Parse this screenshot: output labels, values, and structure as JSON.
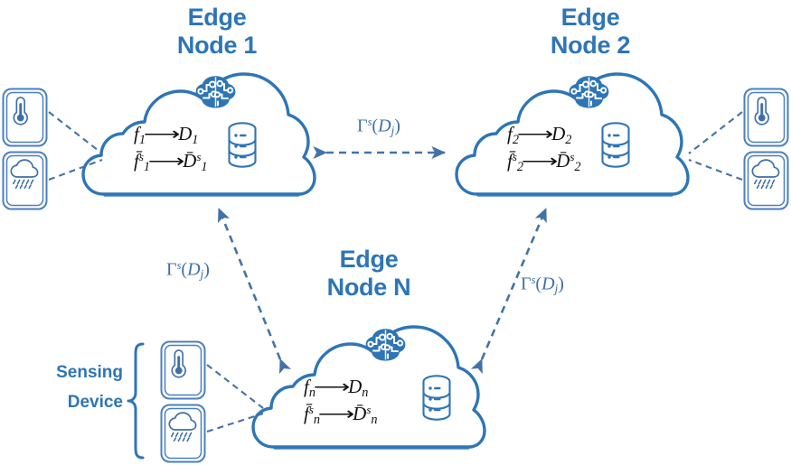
{
  "diagram": {
    "title": "Edge computing federated sensing network",
    "colors": {
      "node_blue": "#2E75B6",
      "arrow_blue": "#4472A8",
      "icon_blue": "#3E6FA8",
      "formula_black": "#111111",
      "background": "#FFFFFF"
    }
  },
  "nodes": [
    {
      "id": "edge-node-1",
      "title": "Edge\nNode 1",
      "formula_line1": {
        "fn": "f",
        "fn_sub": "1",
        "arrow": "⟶",
        "data": "D",
        "data_sub": "1"
      },
      "formula_line2": {
        "fn": "f̄",
        "fn_sup": "s",
        "fn_sub": "1",
        "arrow": "⟶",
        "data": "D̄",
        "data_sup": "s",
        "data_sub": "1"
      },
      "icons": [
        "brain-ai-icon",
        "database-icon"
      ]
    },
    {
      "id": "edge-node-2",
      "title": "Edge\nNode 2",
      "formula_line1": {
        "fn": "f",
        "fn_sub": "2",
        "arrow": "⟶",
        "data": "D",
        "data_sub": "2"
      },
      "formula_line2": {
        "fn": "f̄",
        "fn_sup": "s",
        "fn_sub": "2",
        "arrow": "⟶",
        "data": "D̄",
        "data_sup": "s",
        "data_sub": "2"
      },
      "icons": [
        "brain-ai-icon",
        "database-icon"
      ]
    },
    {
      "id": "edge-node-n",
      "title": "Edge\nNode N",
      "formula_line1": {
        "fn": "f",
        "fn_sub": "n",
        "arrow": "⟶",
        "data": "D",
        "data_sub": "n"
      },
      "formula_line2": {
        "fn": "f̄",
        "fn_sup": "s",
        "fn_sub": "n",
        "arrow": "⟶",
        "data": "D̄",
        "data_sup": "s",
        "data_sub": "n"
      },
      "icons": [
        "brain-ai-icon",
        "database-icon"
      ]
    }
  ],
  "links": [
    {
      "id": "link-node1-node2",
      "label_gamma": "Γ",
      "label_sup": "s",
      "label_arg_open": "(",
      "label_arg": "D",
      "label_arg_sub": "j",
      "label_arg_close": ")",
      "style": "dashed-double-arrow"
    },
    {
      "id": "link-node1-noden",
      "label_gamma": "Γ",
      "label_sup": "s",
      "label_arg_open": "(",
      "label_arg": "D",
      "label_arg_sub": "j",
      "label_arg_close": ")",
      "style": "dashed-double-arrow"
    },
    {
      "id": "link-node2-noden",
      "label_gamma": "Γ",
      "label_sup": "s",
      "label_arg_open": "(",
      "label_arg": "D",
      "label_arg_sub": "j",
      "label_arg_close": ")",
      "style": "dashed-double-arrow"
    }
  ],
  "sensing": {
    "group_label": "Sensing\nDevice",
    "devices": [
      {
        "id": "sensor-left-thermometer",
        "icon": "thermometer-icon"
      },
      {
        "id": "sensor-left-rain",
        "icon": "rain-cloud-icon"
      },
      {
        "id": "sensor-right-thermometer",
        "icon": "thermometer-icon"
      },
      {
        "id": "sensor-right-rain",
        "icon": "rain-cloud-icon"
      },
      {
        "id": "sensor-bottom-thermometer",
        "icon": "thermometer-icon"
      },
      {
        "id": "sensor-bottom-rain",
        "icon": "rain-cloud-icon"
      }
    ]
  }
}
